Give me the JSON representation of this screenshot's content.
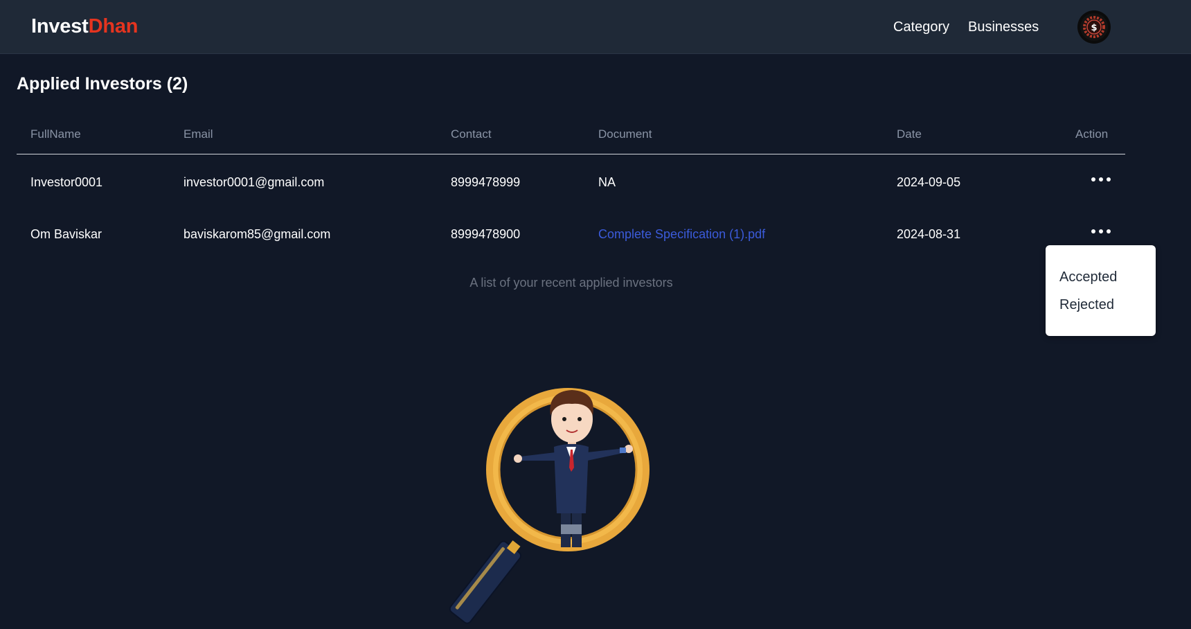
{
  "navbar": {
    "logo_part1": "Invest",
    "logo_part2": "Dhan",
    "links": [
      "Category",
      "Businesses"
    ],
    "avatar_icon": "dollar-badge-icon"
  },
  "page": {
    "title": "Applied Investors (2)"
  },
  "table": {
    "headers": [
      "FullName",
      "Email",
      "Contact",
      "Document",
      "Date",
      "Action"
    ],
    "rows": [
      {
        "name": "Investor0001",
        "email": "investor0001@gmail.com",
        "contact": "8999478999",
        "document": "NA",
        "date": "2024-09-05",
        "action_icon": "more-horizontal-icon"
      },
      {
        "name": "Om Baviskar",
        "email": "baviskarom85@gmail.com",
        "contact": "8999478900",
        "document": "Complete Specification (1).pdf",
        "date": "2024-08-31",
        "action_icon": "more-horizontal-icon"
      }
    ],
    "caption": "A list of your recent applied investors"
  },
  "action_menu": {
    "items": [
      "Accepted",
      "Rejected"
    ]
  },
  "colors": {
    "background": "#111827",
    "navbar": "#1f2937",
    "brand_accent": "#e5341f",
    "link": "#3b5bdb",
    "muted": "#8a94a6"
  }
}
